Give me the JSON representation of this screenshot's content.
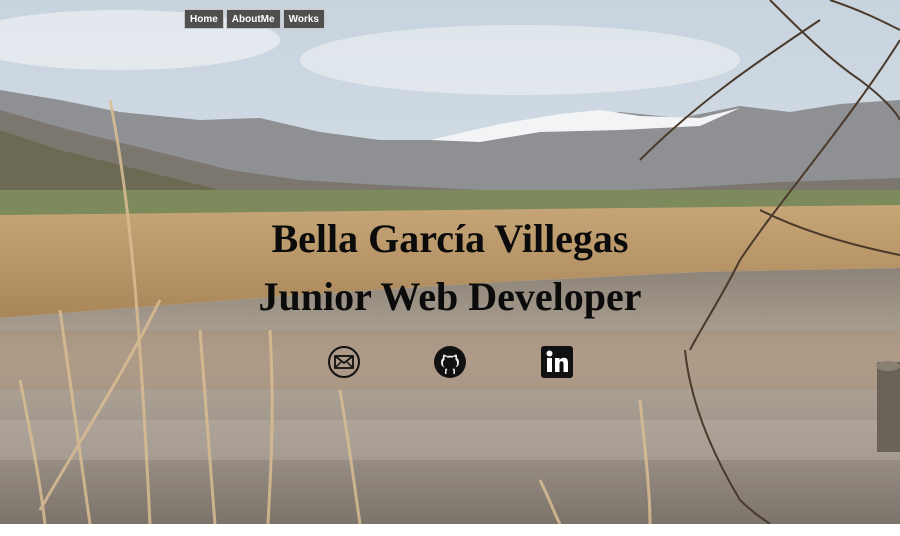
{
  "nav": {
    "items": [
      {
        "label": "Home"
      },
      {
        "label": "AboutMe"
      },
      {
        "label": "Works"
      }
    ]
  },
  "hero": {
    "name": "Bella García Villegas",
    "role": "Junior Web Developer"
  },
  "social": {
    "icons": [
      "envelope-icon",
      "github-icon",
      "linkedin-icon"
    ]
  },
  "colors": {
    "nav_bg": "#4f4f4f",
    "nav_text": "#ffffff",
    "headline": "#0b0b0b",
    "icon": "#111111"
  }
}
